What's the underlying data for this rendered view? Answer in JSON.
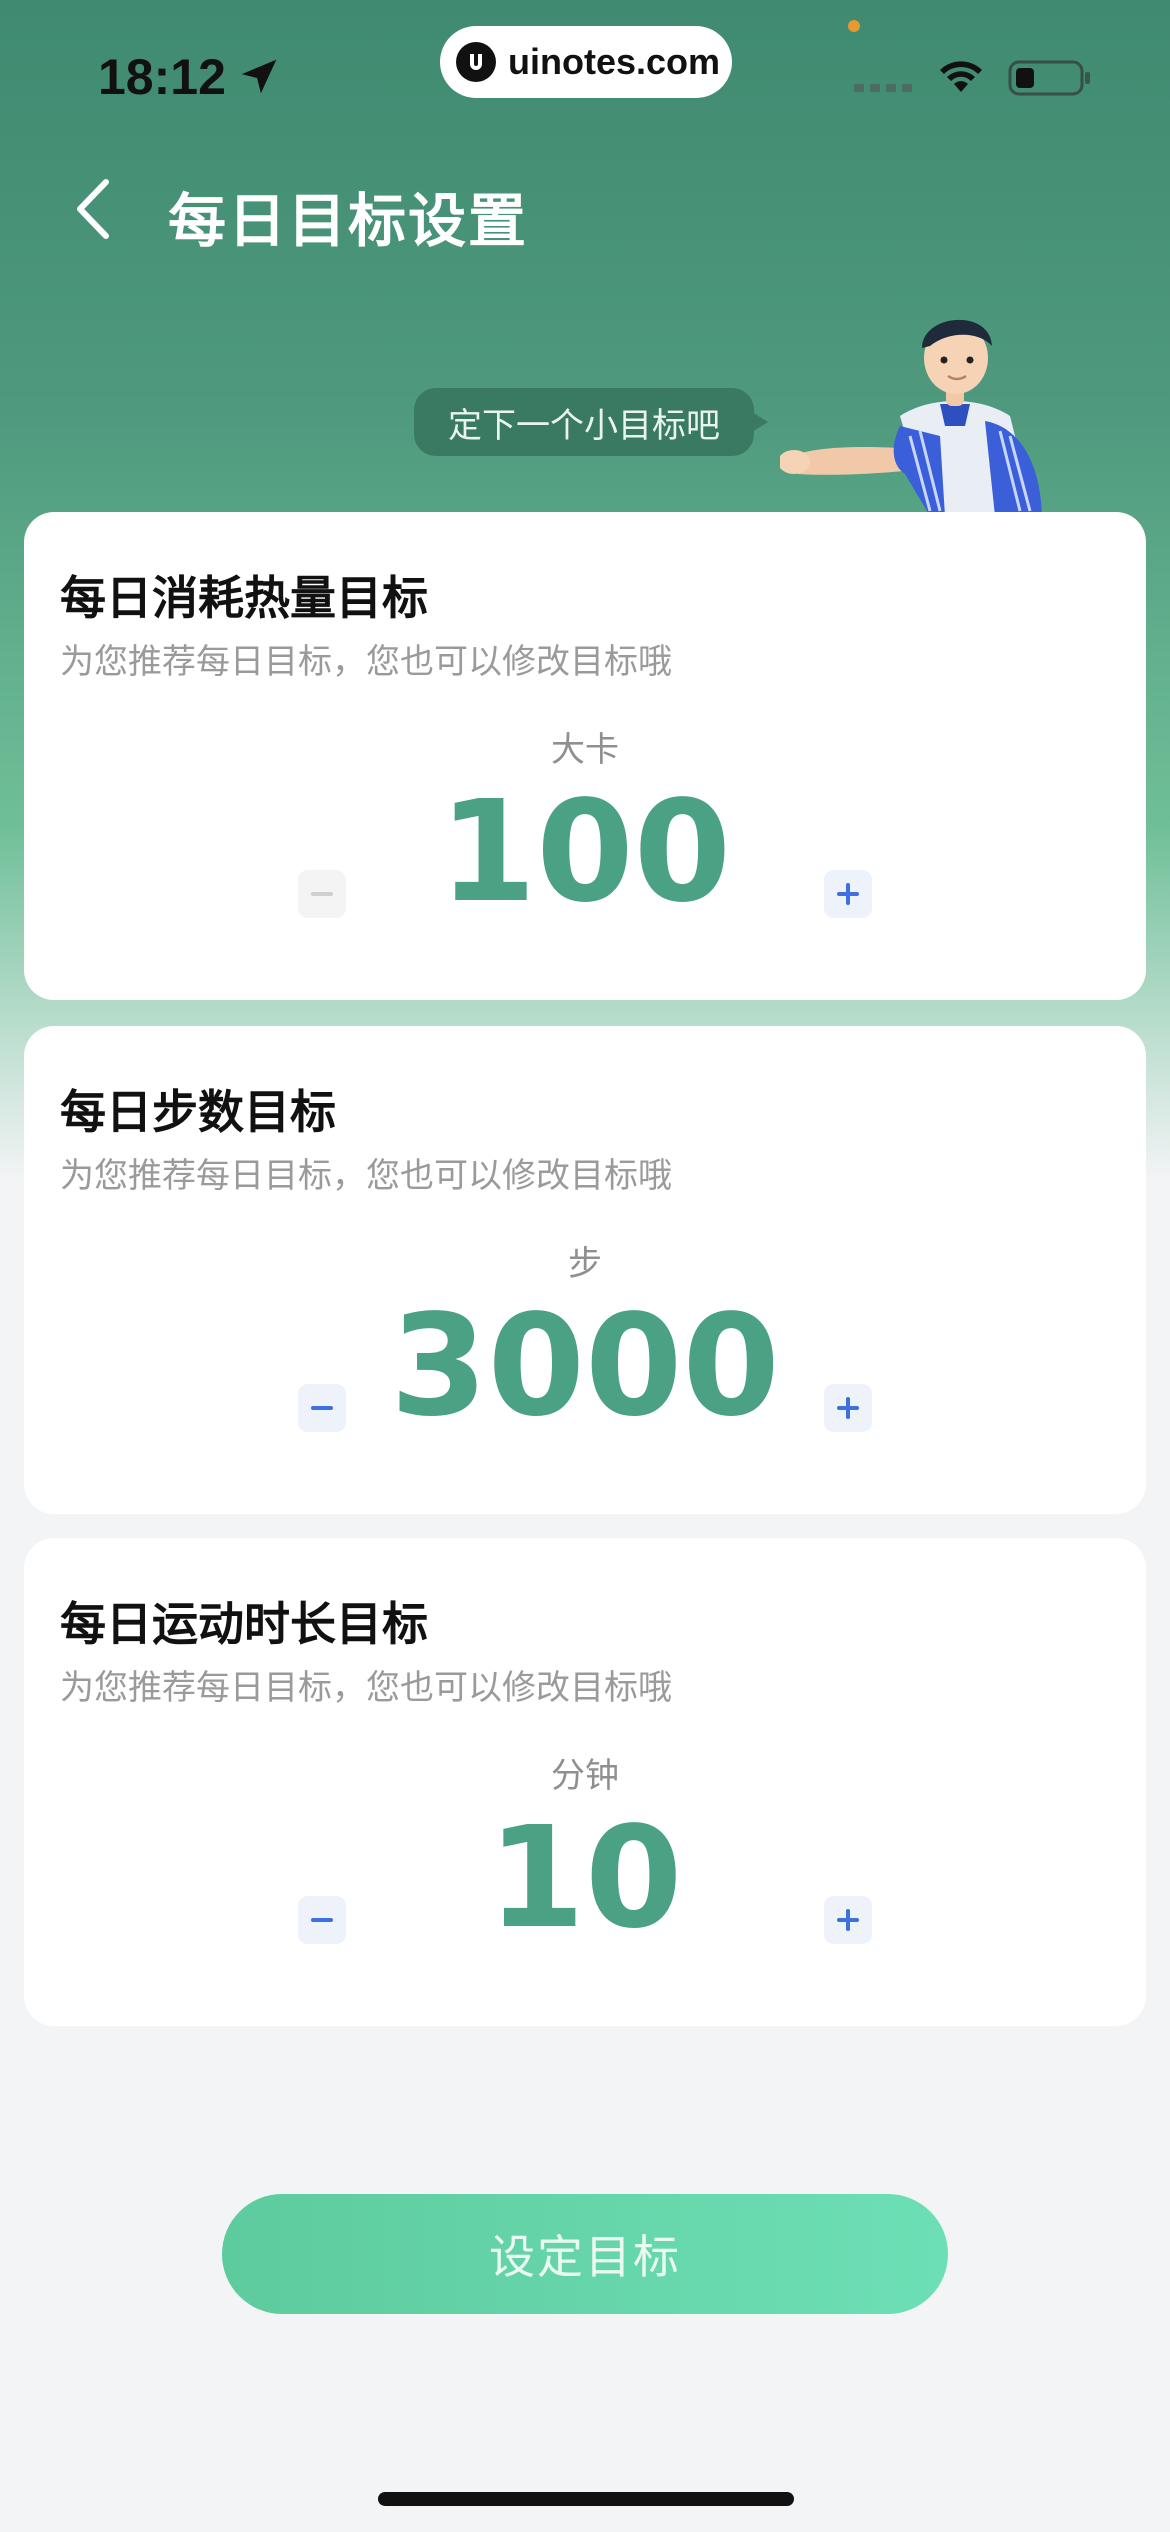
{
  "status_bar": {
    "time": "18:12",
    "url": "uinotes.com"
  },
  "nav": {
    "title": "每日目标设置"
  },
  "bubble": {
    "text": "定下一个小目标吧"
  },
  "cards": [
    {
      "title": "每日消耗热量目标",
      "subtitle": "为您推荐每日目标，您也可以修改目标哦",
      "unit": "大卡",
      "value": "100",
      "minus_disabled": true
    },
    {
      "title": "每日步数目标",
      "subtitle": "为您推荐每日目标，您也可以修改目标哦",
      "unit": "步",
      "value": "3000",
      "minus_disabled": false
    },
    {
      "title": "每日运动时长目标",
      "subtitle": "为您推荐每日目标，您也可以修改目标哦",
      "unit": "分钟",
      "value": "10",
      "minus_disabled": false
    }
  ],
  "cta": {
    "label": "设定目标"
  },
  "colors": {
    "accent": "#4aa184",
    "stepper_icon": "#3f6fe0",
    "header_bg": "#3f8a70",
    "cta_start": "#5ecb9d",
    "cta_end": "#6ddfb6"
  },
  "icons": {
    "back": "chevron-left-icon",
    "location": "location-arrow-icon",
    "wifi": "wifi-icon",
    "battery": "battery-icon",
    "minus": "minus-icon",
    "plus": "plus-icon"
  }
}
